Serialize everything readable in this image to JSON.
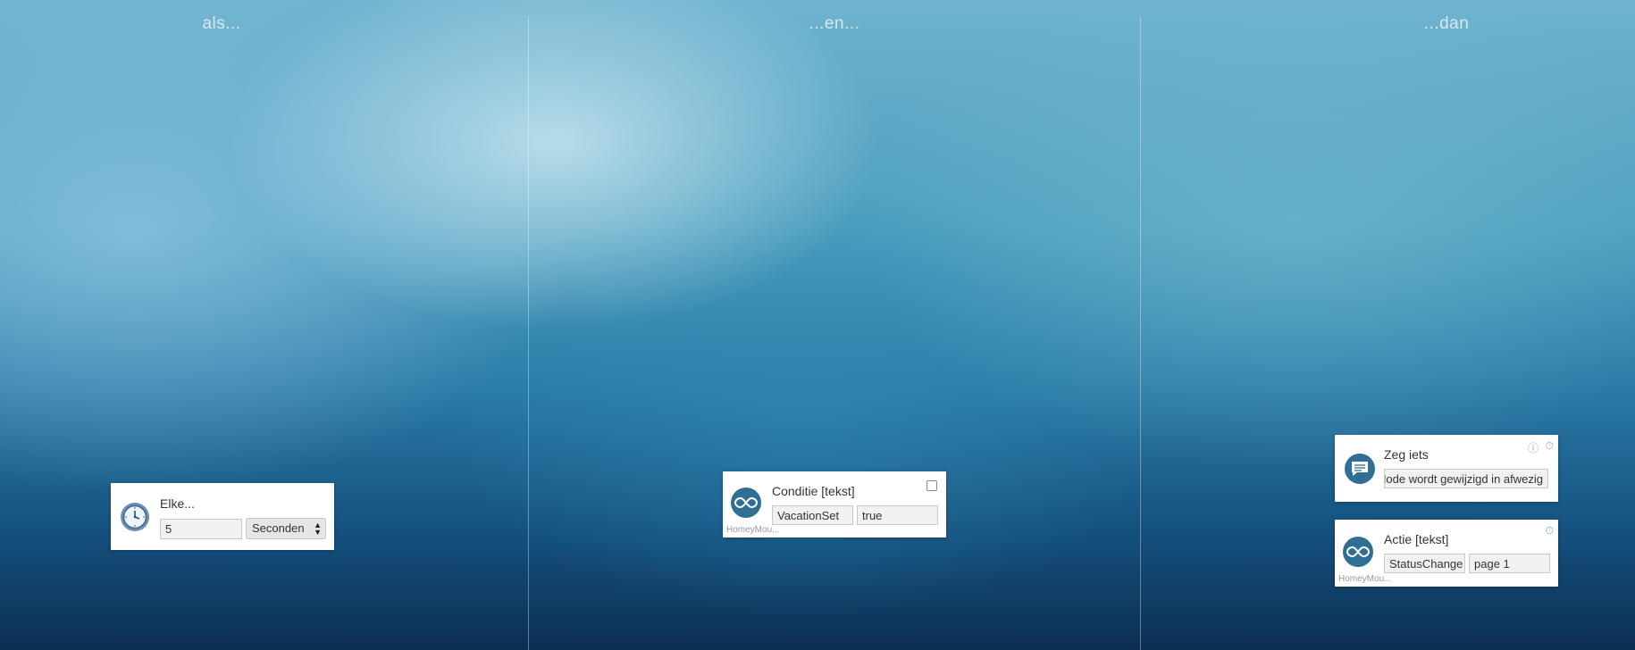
{
  "columns": {
    "when": "als...",
    "and": "...en...",
    "then": "...dan"
  },
  "trigger_card": {
    "title": "Elke...",
    "interval_value": "5",
    "unit_selected": "Seconden",
    "icon": "clock-icon"
  },
  "condition_card": {
    "title": "Conditie [tekst]",
    "field1": "VacationSet",
    "field2": "true",
    "app_label": "HomeyMou...",
    "icon": "infinity-icon"
  },
  "action_say_card": {
    "title": "Zeg iets",
    "text": "Mode wordt gewijzigd in afwezig",
    "icon": "speech-bubble-icon"
  },
  "action_text_card": {
    "title": "Actie [tekst]",
    "field1": "StatusChange",
    "field2": "page 1",
    "app_label": "HomeyMou...",
    "icon": "infinity-icon"
  },
  "colors": {
    "icon_blue": "#2f6f96",
    "card_bg": "#ffffff"
  }
}
